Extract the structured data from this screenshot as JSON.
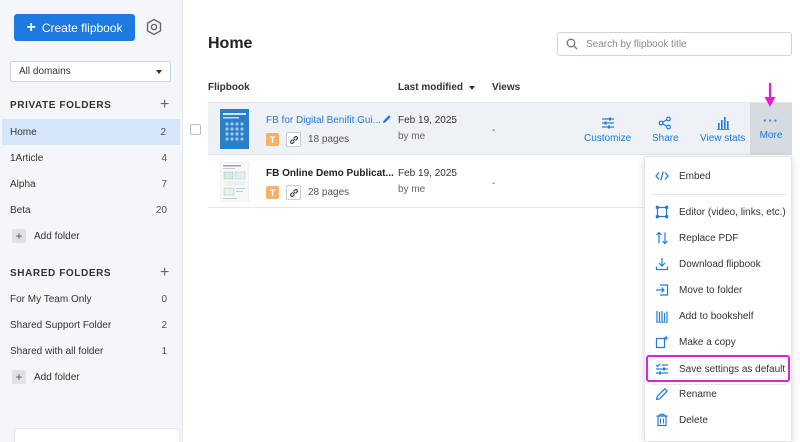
{
  "sidebar": {
    "create_label": "Create flipbook",
    "domain_select": "All domains",
    "private_header": "PRIVATE FOLDERS",
    "private_folders": [
      {
        "label": "Home",
        "count": "2",
        "active": true
      },
      {
        "label": "1Article",
        "count": "4"
      },
      {
        "label": "Alpha",
        "count": "7"
      },
      {
        "label": "Beta",
        "count": "20"
      }
    ],
    "add_folder": "Add folder",
    "shared_header": "SHARED FOLDERS",
    "shared_folders": [
      {
        "label": "For My Team Only",
        "count": "0"
      },
      {
        "label": "Shared Support Folder",
        "count": "2"
      },
      {
        "label": "Shared with all folder",
        "count": "1"
      }
    ]
  },
  "main": {
    "title": "Home",
    "search_placeholder": "Search by flipbook title",
    "columns": {
      "flipbook": "Flipbook",
      "last_modified": "Last modified",
      "views": "Views"
    },
    "rows": [
      {
        "title": "FB for Digital Benifit Gui...",
        "badge": "T",
        "pages": "18 pages",
        "date": "Feb 19, 2025",
        "by": "by me",
        "views": "-"
      },
      {
        "title": "FB Online Demo Publicat...",
        "badge": "T",
        "pages": "28 pages",
        "date": "Feb 19, 2025",
        "by": "by me",
        "views": "-"
      }
    ],
    "actions": {
      "customize": "Customize",
      "share": "Share",
      "view_stats": "View stats",
      "more": "More"
    }
  },
  "menu": {
    "items": [
      "Embed",
      "Editor (video, links, etc.)",
      "Replace PDF",
      "Download flipbook",
      "Move to folder",
      "Add to bookshelf",
      "Make a copy",
      "Save settings as default",
      "Rename",
      "Delete"
    ]
  },
  "colors": {
    "accent": "#1f7ae0",
    "highlight": "#e020d2",
    "active_folder": "#d5e6f9"
  }
}
